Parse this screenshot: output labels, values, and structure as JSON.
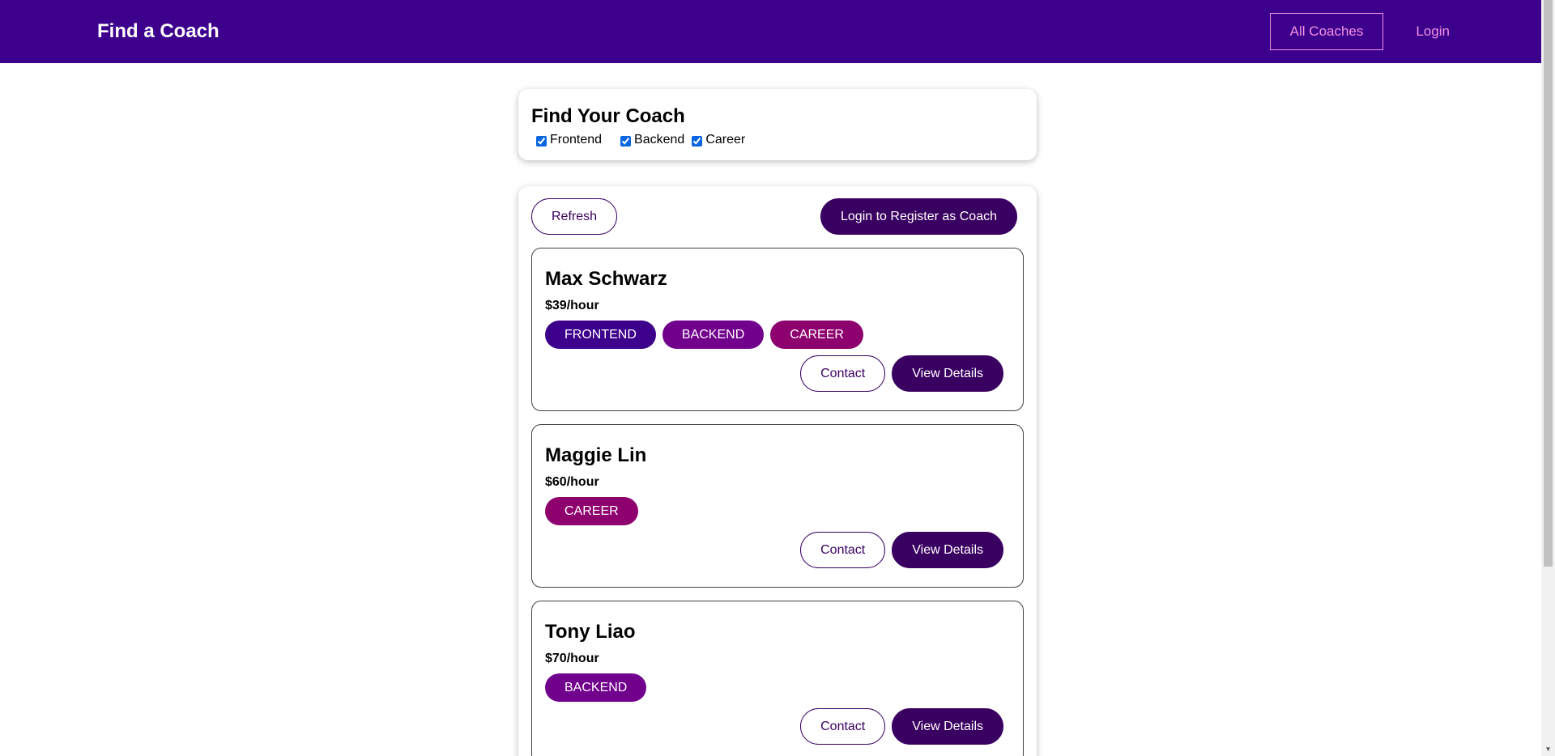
{
  "header": {
    "brand": "Find a Coach",
    "nav": [
      {
        "label": "All Coaches"
      },
      {
        "label": "Login"
      }
    ]
  },
  "filter": {
    "title": "Find Your Coach",
    "options": [
      {
        "label": "Frontend",
        "checked": true
      },
      {
        "label": "Backend",
        "checked": true
      },
      {
        "label": "Career",
        "checked": true
      }
    ]
  },
  "controls": {
    "refresh_label": "Refresh",
    "register_label": "Login to Register as Coach"
  },
  "badge_colors": {
    "FRONTEND": "#3d008d",
    "BACKEND": "#71008d",
    "CAREER": "#8d006e"
  },
  "coaches": [
    {
      "name": "Max Schwarz",
      "rate": "$39/hour",
      "areas": [
        "FRONTEND",
        "BACKEND",
        "CAREER"
      ],
      "contact_label": "Contact",
      "details_label": "View Details"
    },
    {
      "name": "Maggie Lin",
      "rate": "$60/hour",
      "areas": [
        "CAREER"
      ],
      "contact_label": "Contact",
      "details_label": "View Details"
    },
    {
      "name": "Tony Liao",
      "rate": "$70/hour",
      "areas": [
        "BACKEND"
      ],
      "contact_label": "Contact",
      "details_label": "View Details"
    }
  ]
}
